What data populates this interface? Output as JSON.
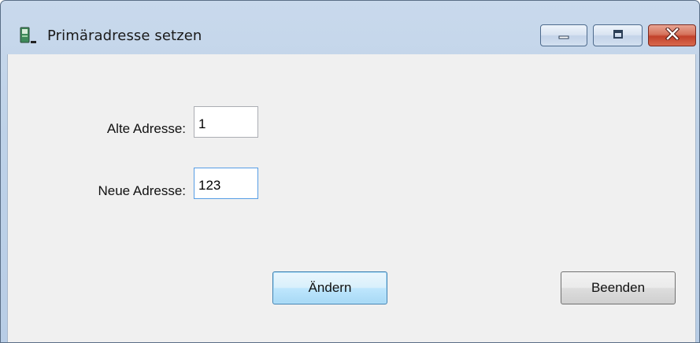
{
  "window": {
    "title": "Primäradresse setzen",
    "icon": "app-icon",
    "controls": {
      "minimize": "minimize-icon",
      "maximize": "maximize-icon",
      "close": "close-icon"
    }
  },
  "form": {
    "old_address_label": "Alte Adresse:",
    "old_address_value": "1",
    "new_address_label": "Neue Adresse:",
    "new_address_value": "123"
  },
  "buttons": {
    "change_label": "Ändern",
    "exit_label": "Beenden"
  },
  "colors": {
    "titlebar": "#bed2e8",
    "client_bg": "#f0f0f0",
    "close_button": "#c2412a",
    "default_button_border": "#3c7fb1",
    "focus_border": "#569de5"
  }
}
